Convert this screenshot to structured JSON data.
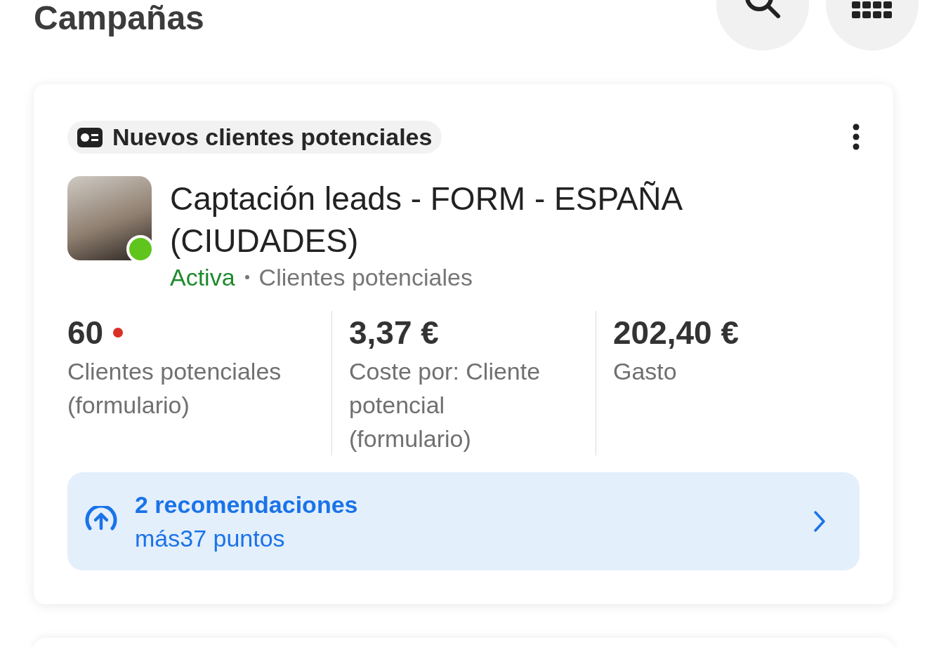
{
  "page": {
    "title": "Campañas"
  },
  "campaign": {
    "type_badge": "Nuevos clientes potenciales",
    "name": "Captación leads - FORM - ESPAÑA (CIUDADES)",
    "status": {
      "label": "Activa",
      "active": true
    },
    "objective": "Clientes potenciales",
    "metrics": [
      {
        "value": "60",
        "alert": true,
        "label": "Clientes potenciales (formulario)"
      },
      {
        "value": "3,37 €",
        "alert": false,
        "label": "Coste por: Cliente potencial (formulario)"
      },
      {
        "value": "202,40 €",
        "alert": false,
        "label": "Gasto"
      }
    ],
    "recommendations": {
      "title": "2 recomendaciones",
      "subtitle": "más37 puntos"
    }
  }
}
